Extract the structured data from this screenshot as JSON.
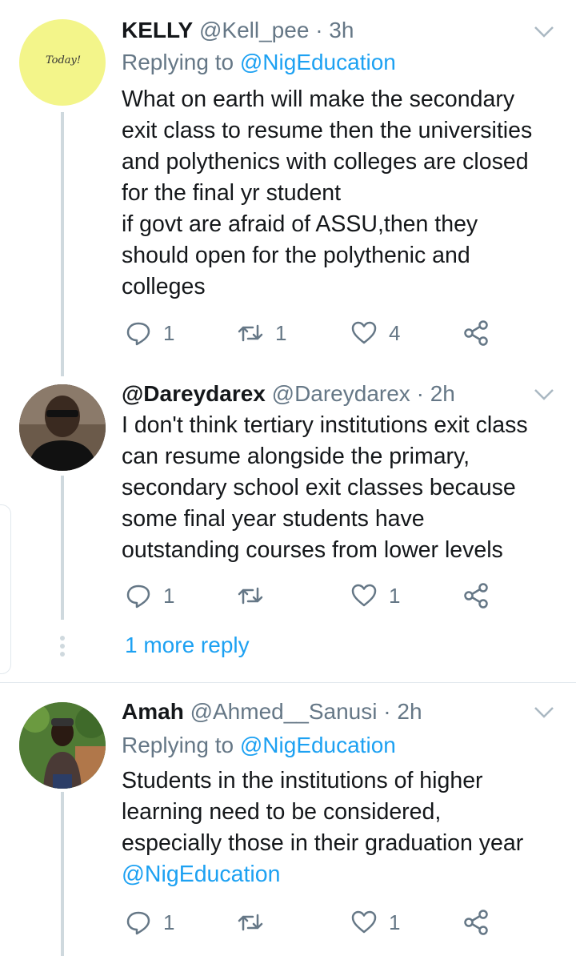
{
  "tweets": [
    {
      "name": "KELLY",
      "handle": "@Kell_pee",
      "time": "3h",
      "replying_prefix": "Replying to",
      "replying_to": "@NigEducation",
      "text": "What on earth will make the secondary\nexit class to resume then the universities\nand polythenics with colleges are closed\nfor the final yr student\nif govt are afraid of ASSU,then they\nshould open for the polythenic and\ncolleges",
      "avatar_text": "Today!",
      "replies": "1",
      "retweets": "1",
      "likes": "4"
    },
    {
      "name": "@Dareydarex",
      "handle": "@Dareydarex",
      "time": "2h",
      "text": "I don't think tertiary institutions exit class\ncan resume alongside the primary,\nsecondary school exit classes because\nsome final year students have\noutstanding courses from lower levels",
      "replies": "1",
      "retweets": "",
      "likes": "1"
    },
    {
      "name": "Amah",
      "handle": "@Ahmed__Sanusi",
      "time": "2h",
      "replying_prefix": "Replying to",
      "replying_to": "@NigEducation",
      "text": "Students in the institutions of higher\nlearning need to be considered,\nespecially those in their graduation year",
      "mention_line": "@NigEducation",
      "replies": "1",
      "retweets": "",
      "likes": "1"
    }
  ],
  "more_reply_label": "1 more reply",
  "separator": "·",
  "colors": {
    "accent": "#1da1f2",
    "muted": "#657786",
    "line": "#cfd9de"
  },
  "icons": [
    "reply-icon",
    "retweet-icon",
    "like-icon",
    "share-icon",
    "chevron-down-icon"
  ]
}
